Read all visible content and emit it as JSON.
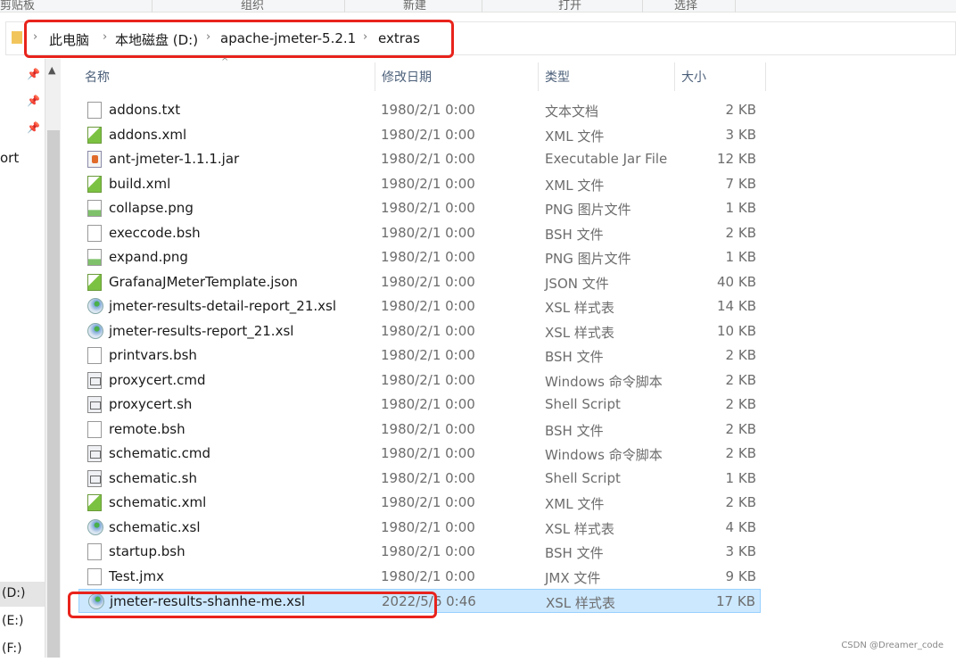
{
  "ribbon": {
    "groups": [
      "剪贴板",
      "组织",
      "新建",
      "打开",
      "选择"
    ]
  },
  "address": {
    "segments": [
      "此电脑",
      "本地磁盘 (D:)",
      "apache-jmeter-5.2.1",
      "extras"
    ]
  },
  "nav": {
    "partial_label": "ort",
    "drives": [
      "(D:)",
      "(E:)",
      "(F:)"
    ]
  },
  "columns": {
    "name": "名称",
    "date": "修改日期",
    "type": "类型",
    "size": "大小"
  },
  "files": [
    {
      "name": "addons.txt",
      "date": "1980/2/1 0:00",
      "type": "文本文档",
      "size": "2 KB",
      "icon": "txt"
    },
    {
      "name": "addons.xml",
      "date": "1980/2/1 0:00",
      "type": "XML 文件",
      "size": "3 KB",
      "icon": "xml"
    },
    {
      "name": "ant-jmeter-1.1.1.jar",
      "date": "1980/2/1 0:00",
      "type": "Executable Jar File",
      "size": "12 KB",
      "icon": "jar"
    },
    {
      "name": "build.xml",
      "date": "1980/2/1 0:00",
      "type": "XML 文件",
      "size": "7 KB",
      "icon": "xml"
    },
    {
      "name": "collapse.png",
      "date": "1980/2/1 0:00",
      "type": "PNG 图片文件",
      "size": "1 KB",
      "icon": "png"
    },
    {
      "name": "execcode.bsh",
      "date": "1980/2/1 0:00",
      "type": "BSH 文件",
      "size": "2 KB",
      "icon": "txt"
    },
    {
      "name": "expand.png",
      "date": "1980/2/1 0:00",
      "type": "PNG 图片文件",
      "size": "1 KB",
      "icon": "png"
    },
    {
      "name": "GrafanaJMeterTemplate.json",
      "date": "1980/2/1 0:00",
      "type": "JSON 文件",
      "size": "40 KB",
      "icon": "xml"
    },
    {
      "name": "jmeter-results-detail-report_21.xsl",
      "date": "1980/2/1 0:00",
      "type": "XSL 样式表",
      "size": "14 KB",
      "icon": "xsl"
    },
    {
      "name": "jmeter-results-report_21.xsl",
      "date": "1980/2/1 0:00",
      "type": "XSL 样式表",
      "size": "10 KB",
      "icon": "xsl"
    },
    {
      "name": "printvars.bsh",
      "date": "1980/2/1 0:00",
      "type": "BSH 文件",
      "size": "2 KB",
      "icon": "txt"
    },
    {
      "name": "proxycert.cmd",
      "date": "1980/2/1 0:00",
      "type": "Windows 命令脚本",
      "size": "2 KB",
      "icon": "cmd"
    },
    {
      "name": "proxycert.sh",
      "date": "1980/2/1 0:00",
      "type": "Shell Script",
      "size": "2 KB",
      "icon": "cmd"
    },
    {
      "name": "remote.bsh",
      "date": "1980/2/1 0:00",
      "type": "BSH 文件",
      "size": "2 KB",
      "icon": "txt"
    },
    {
      "name": "schematic.cmd",
      "date": "1980/2/1 0:00",
      "type": "Windows 命令脚本",
      "size": "2 KB",
      "icon": "cmd"
    },
    {
      "name": "schematic.sh",
      "date": "1980/2/1 0:00",
      "type": "Shell Script",
      "size": "1 KB",
      "icon": "cmd"
    },
    {
      "name": "schematic.xml",
      "date": "1980/2/1 0:00",
      "type": "XML 文件",
      "size": "2 KB",
      "icon": "xml"
    },
    {
      "name": "schematic.xsl",
      "date": "1980/2/1 0:00",
      "type": "XSL 样式表",
      "size": "4 KB",
      "icon": "xsl"
    },
    {
      "name": "startup.bsh",
      "date": "1980/2/1 0:00",
      "type": "BSH 文件",
      "size": "3 KB",
      "icon": "txt"
    },
    {
      "name": "Test.jmx",
      "date": "1980/2/1 0:00",
      "type": "JMX 文件",
      "size": "9 KB",
      "icon": "txt"
    },
    {
      "name": "jmeter-results-shanhe-me.xsl",
      "date": "2022/5/6 0:46",
      "type": "XSL 样式表",
      "size": "17 KB",
      "icon": "xsl",
      "selected": true
    }
  ],
  "watermark": "CSDN @Dreamer_code",
  "colors": {
    "selection": "#cce8ff",
    "highlight_box": "#e8231c"
  }
}
